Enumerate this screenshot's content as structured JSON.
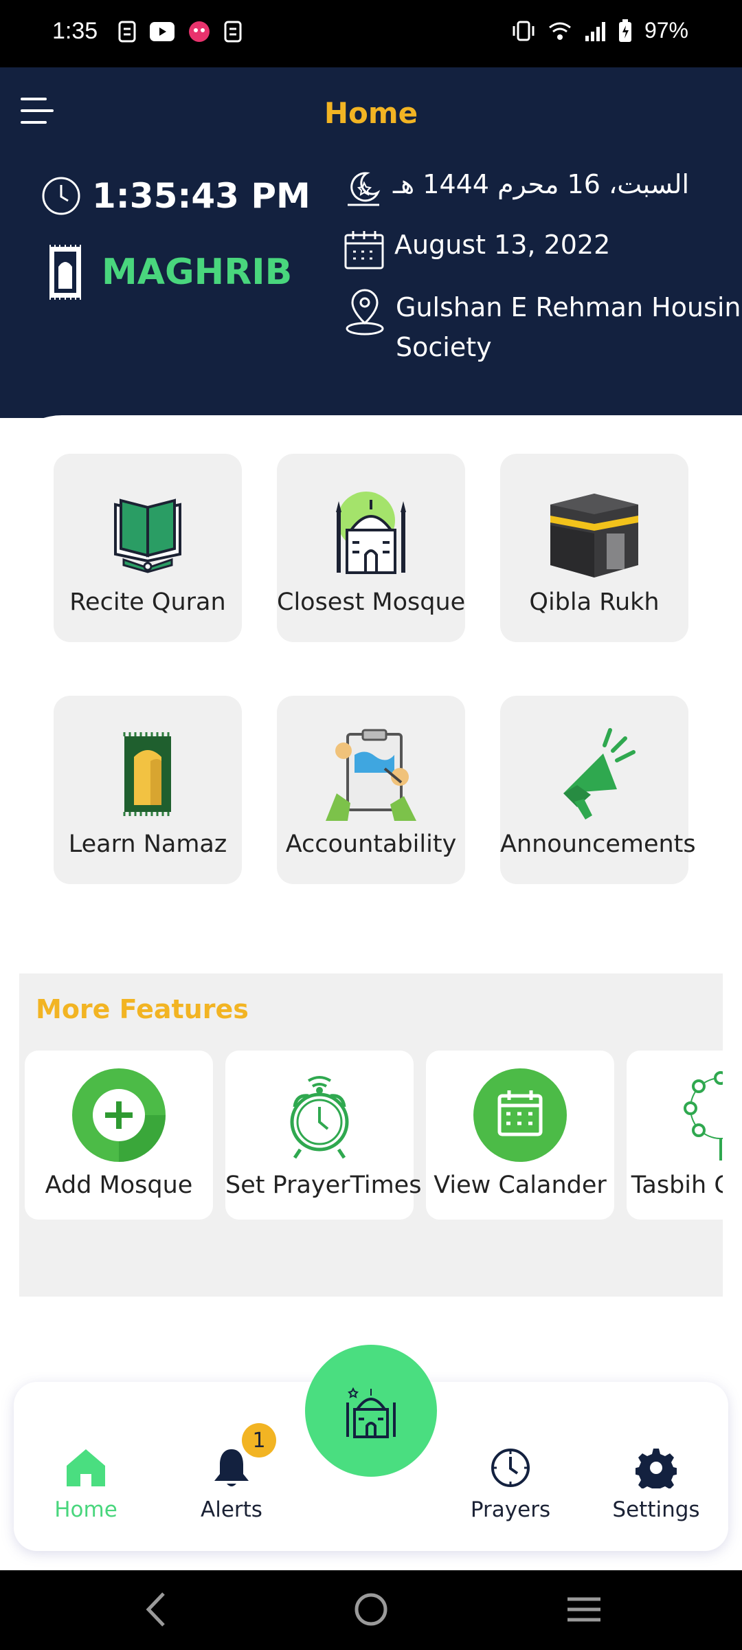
{
  "status_bar": {
    "time": "1:35",
    "battery": "97%",
    "icons": [
      "notification-s-icon",
      "youtube-icon",
      "app-icon",
      "notification-s-icon",
      "vibrate-icon",
      "wifi-icon",
      "signal-icon",
      "battery-charging-icon"
    ]
  },
  "header": {
    "title": "Home",
    "clock": "1:35:43 PM",
    "prayer": "MAGHRIB",
    "hijri_date": "السبت، 16 محرم 1444 هـ",
    "gregorian_date": "August 13, 2022",
    "location": "Gulshan E Rehman Housing Society"
  },
  "tiles": [
    {
      "label": "Recite Quran",
      "icon": "quran-icon"
    },
    {
      "label": "Closest Mosque",
      "icon": "mosque-icon"
    },
    {
      "label": "Qibla Rukh",
      "icon": "kaaba-icon"
    },
    {
      "label": "Learn Namaz",
      "icon": "prayer-mat-icon"
    },
    {
      "label": "Accountability",
      "icon": "clipboard-icon"
    },
    {
      "label": "Announcements",
      "icon": "megaphone-icon"
    }
  ],
  "more_features": {
    "title": "More Features",
    "items": [
      {
        "label": "Add Mosque",
        "icon": "add-icon"
      },
      {
        "label": "Set PrayerTimes",
        "icon": "alarm-clock-icon"
      },
      {
        "label": "View Calander",
        "icon": "calendar-icon"
      },
      {
        "label": "Tasbih Counter",
        "icon": "tasbih-icon"
      }
    ]
  },
  "bottom_nav": {
    "items": [
      {
        "label": "Home",
        "icon": "home-icon",
        "active": true
      },
      {
        "label": "Alerts",
        "icon": "bell-icon",
        "badge": "1"
      },
      {
        "label": "Prayers",
        "icon": "clock-icon"
      },
      {
        "label": "Settings",
        "icon": "gear-icon"
      }
    ],
    "center_icon": "mosque-icon"
  },
  "colors": {
    "header_bg": "#13213f",
    "accent_yellow": "#f2b423",
    "accent_green": "#4ade80",
    "tile_bg": "#f0f0f0"
  }
}
